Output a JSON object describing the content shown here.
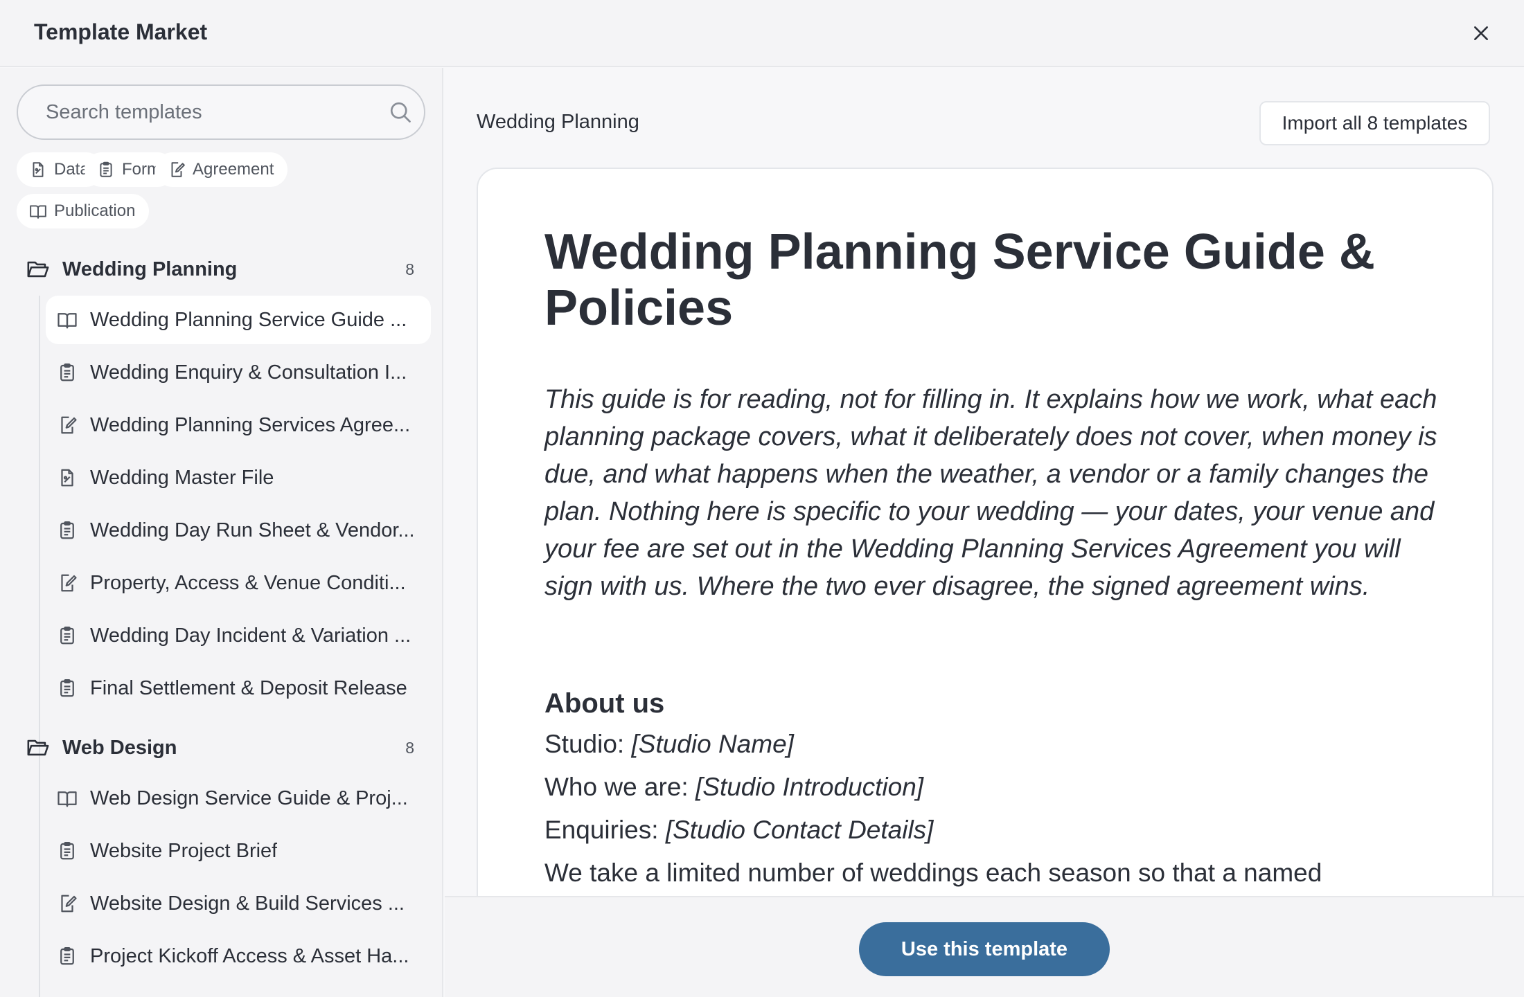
{
  "header": {
    "title": "Template Market"
  },
  "search": {
    "placeholder": "Search templates",
    "value": ""
  },
  "filters": [
    {
      "label": "Data",
      "icon": "data-icon"
    },
    {
      "label": "Form",
      "icon": "form-icon"
    },
    {
      "label": "Agreement",
      "icon": "agreement-icon"
    },
    {
      "label": "Publication",
      "icon": "publication-icon"
    }
  ],
  "groups": [
    {
      "name": "Wedding Planning",
      "count": "8",
      "items": [
        {
          "label": "Wedding Planning Service Guide ...",
          "icon": "publication-icon",
          "selected": true
        },
        {
          "label": "Wedding Enquiry & Consultation I...",
          "icon": "form-icon"
        },
        {
          "label": "Wedding Planning Services Agree...",
          "icon": "agreement-icon"
        },
        {
          "label": "Wedding Master File",
          "icon": "data-icon"
        },
        {
          "label": "Wedding Day Run Sheet & Vendor...",
          "icon": "form-icon"
        },
        {
          "label": "Property, Access & Venue Conditi...",
          "icon": "agreement-icon"
        },
        {
          "label": "Wedding Day Incident & Variation ...",
          "icon": "form-icon"
        },
        {
          "label": "Final Settlement & Deposit Release",
          "icon": "form-icon"
        }
      ]
    },
    {
      "name": "Web Design",
      "count": "8",
      "items": [
        {
          "label": "Web Design Service Guide & Proj...",
          "icon": "publication-icon"
        },
        {
          "label": "Website Project Brief",
          "icon": "form-icon"
        },
        {
          "label": "Website Design & Build Services ...",
          "icon": "agreement-icon"
        },
        {
          "label": "Project Kickoff Access & Asset Ha...",
          "icon": "form-icon"
        }
      ]
    }
  ],
  "main": {
    "title": "Wedding Planning",
    "import_label": "Import all 8 templates"
  },
  "document": {
    "title": "Wedding Planning Service Guide & Policies",
    "intro": "This guide is for reading, not for filling in. It explains how we work, what each planning package covers, what it deliberately does not cover, when money is due, and what happens when the weather, a vendor or a family changes the plan. Nothing here is specific to your wedding — your dates, your venue and your fee are set out in the Wedding Planning Services Agreement you will sign with us. Where the two ever disagree, the signed agreement wins.",
    "about_heading": "About us",
    "studio_label": "Studio: ",
    "studio_value": "[Studio Name]",
    "who_label": "Who we are: ",
    "who_value": "[Studio Introduction]",
    "enquiries_label": "Enquiries: ",
    "enquiries_value": "[Studio Contact Details]",
    "body_line": "We take a limited number of weddings each season so that a named"
  },
  "footer": {
    "use_label": "Use this template"
  },
  "colors": {
    "primary": "#3a6e9c",
    "background": "#f4f4f6",
    "text": "#2b2f38"
  }
}
